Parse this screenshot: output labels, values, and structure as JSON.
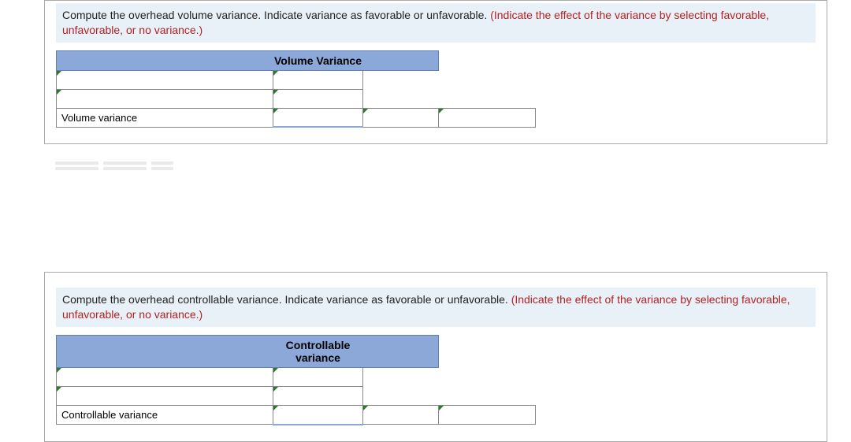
{
  "section1": {
    "instruction_main": "Compute the overhead volume variance. Indicate variance as favorable or unfavorable. ",
    "instruction_red": "(Indicate the effect of the variance by selecting favorable, unfavorable, or no variance.)",
    "table_header": "Volume Variance",
    "row_label": "Volume variance"
  },
  "section2": {
    "instruction_main": "Compute the overhead controllable variance. Indicate variance as favorable or unfavorable. ",
    "instruction_red": "(Indicate the effect of the variance by selecting favorable, unfavorable, or no variance.)",
    "table_header": "Controllable variance",
    "row_label": "Controllable variance"
  }
}
